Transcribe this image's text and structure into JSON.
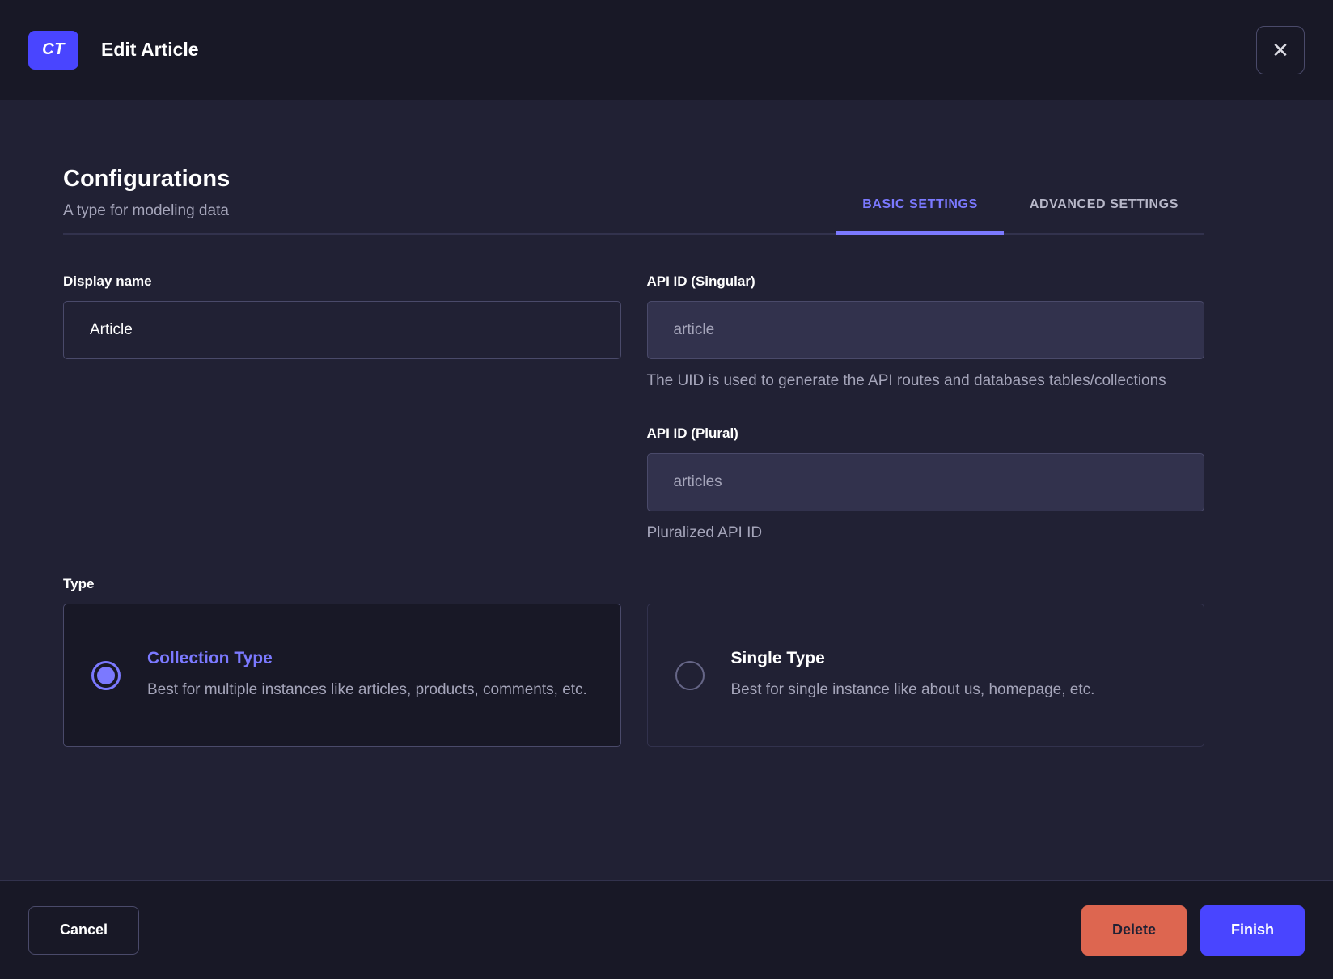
{
  "header": {
    "badge": "CT",
    "title": "Edit Article",
    "close_icon": "✕"
  },
  "main": {
    "title": "Configurations",
    "subtitle": "A type for modeling data",
    "tabs": [
      {
        "label": "BASIC SETTINGS",
        "active": true
      },
      {
        "label": "ADVANCED SETTINGS",
        "active": false
      }
    ],
    "fields": {
      "display_name": {
        "label": "Display name",
        "value": "Article"
      },
      "api_id_singular": {
        "label": "API ID (Singular)",
        "value": "article",
        "hint": "The UID is used to generate the API routes and databases tables/collections"
      },
      "api_id_plural": {
        "label": "API ID (Plural)",
        "value": "articles",
        "hint": "Pluralized API ID"
      }
    },
    "type": {
      "label": "Type",
      "options": [
        {
          "title": "Collection Type",
          "description": "Best for multiple instances like articles, products, comments, etc.",
          "selected": true
        },
        {
          "title": "Single Type",
          "description": "Best for single instance like about us, homepage, etc.",
          "selected": false
        }
      ]
    }
  },
  "footer": {
    "cancel_label": "Cancel",
    "delete_label": "Delete",
    "finish_label": "Finish"
  },
  "colors": {
    "primary": "#4945ff",
    "primary_light": "#7b79ff",
    "danger": "#dd6650",
    "header_bg": "#181826",
    "body_bg": "#212134"
  }
}
